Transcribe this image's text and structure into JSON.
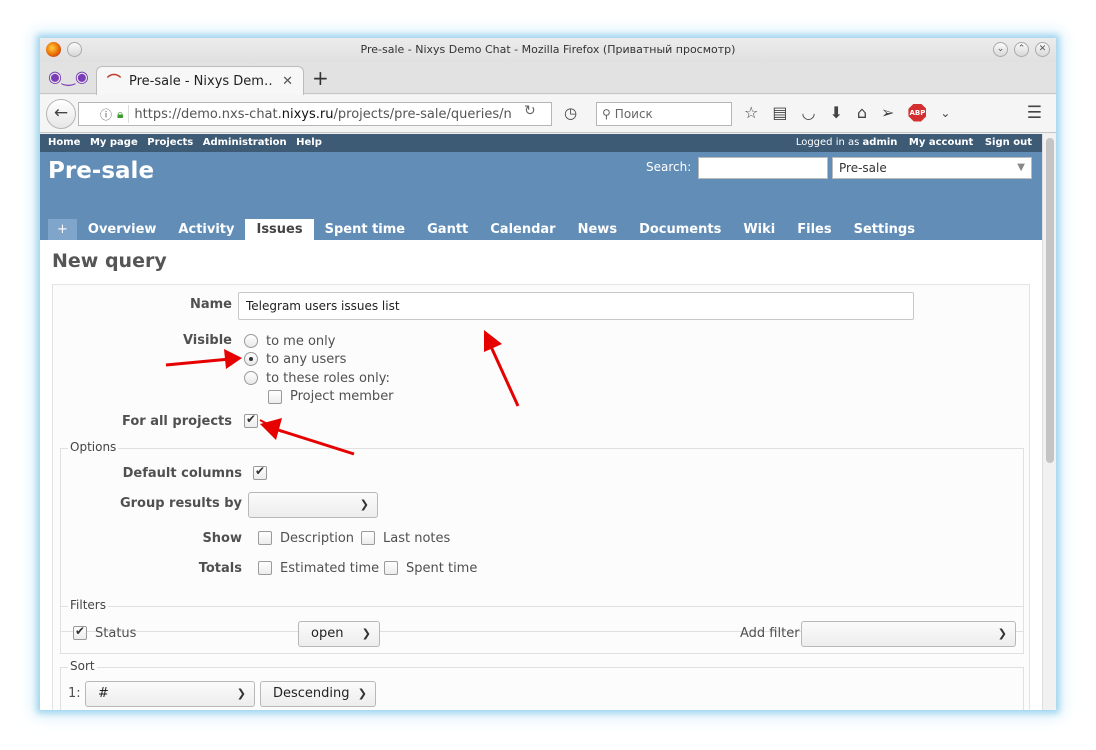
{
  "window": {
    "title": "Pre-sale - Nixys Demo Chat - Mozilla Firefox (Приватный просмотр)"
  },
  "browser": {
    "tab_label": "Pre-sale - Nixys Dem…",
    "url_prefix": "https://demo.nxs-chat.",
    "url_host": "nixys.ru",
    "url_path": "/projects/pre-sale/queries/n",
    "search_placeholder": "Поиск",
    "abp_label": "ABP"
  },
  "topmenu": {
    "items": [
      "Home",
      "My page",
      "Projects",
      "Administration",
      "Help"
    ],
    "logged_in_prefix": "Logged in as",
    "user": "admin",
    "my_account": "My account",
    "sign_out": "Sign out"
  },
  "header": {
    "project_title": "Pre-sale",
    "search_label": "Search:",
    "project_select": "Pre-sale"
  },
  "project_tabs": {
    "plus": "+",
    "items": [
      "Overview",
      "Activity",
      "Issues",
      "Spent time",
      "Gantt",
      "Calendar",
      "News",
      "Documents",
      "Wiki",
      "Files",
      "Settings"
    ],
    "active": "Issues"
  },
  "form": {
    "page_title": "New query",
    "name_label": "Name",
    "name_value": "Telegram users issues list",
    "visible_label": "Visible",
    "visible_options": [
      "to me only",
      "to any users",
      "to these roles only:"
    ],
    "visible_selected": "to any users",
    "role_project_member": "Project member",
    "for_all_projects_label": "For all projects",
    "for_all_projects_checked": true
  },
  "options": {
    "legend": "Options",
    "default_columns_label": "Default columns",
    "default_columns_checked": true,
    "group_results_label": "Group results by",
    "group_results_value": "",
    "show_label": "Show",
    "show_description": "Description",
    "show_last_notes": "Last notes",
    "totals_label": "Totals",
    "totals_estimated": "Estimated time",
    "totals_spent": "Spent time"
  },
  "filters": {
    "legend": "Filters",
    "status_label": "Status",
    "status_checked": true,
    "status_operator": "open",
    "add_filter_label": "Add filter",
    "add_filter_value": ""
  },
  "sort": {
    "legend": "Sort",
    "row_index": "1:",
    "field": "#",
    "direction": "Descending"
  },
  "colors": {
    "header_blue": "#628db6",
    "topmenu_blue": "#3e5b76",
    "annotation_red": "#e60000"
  }
}
